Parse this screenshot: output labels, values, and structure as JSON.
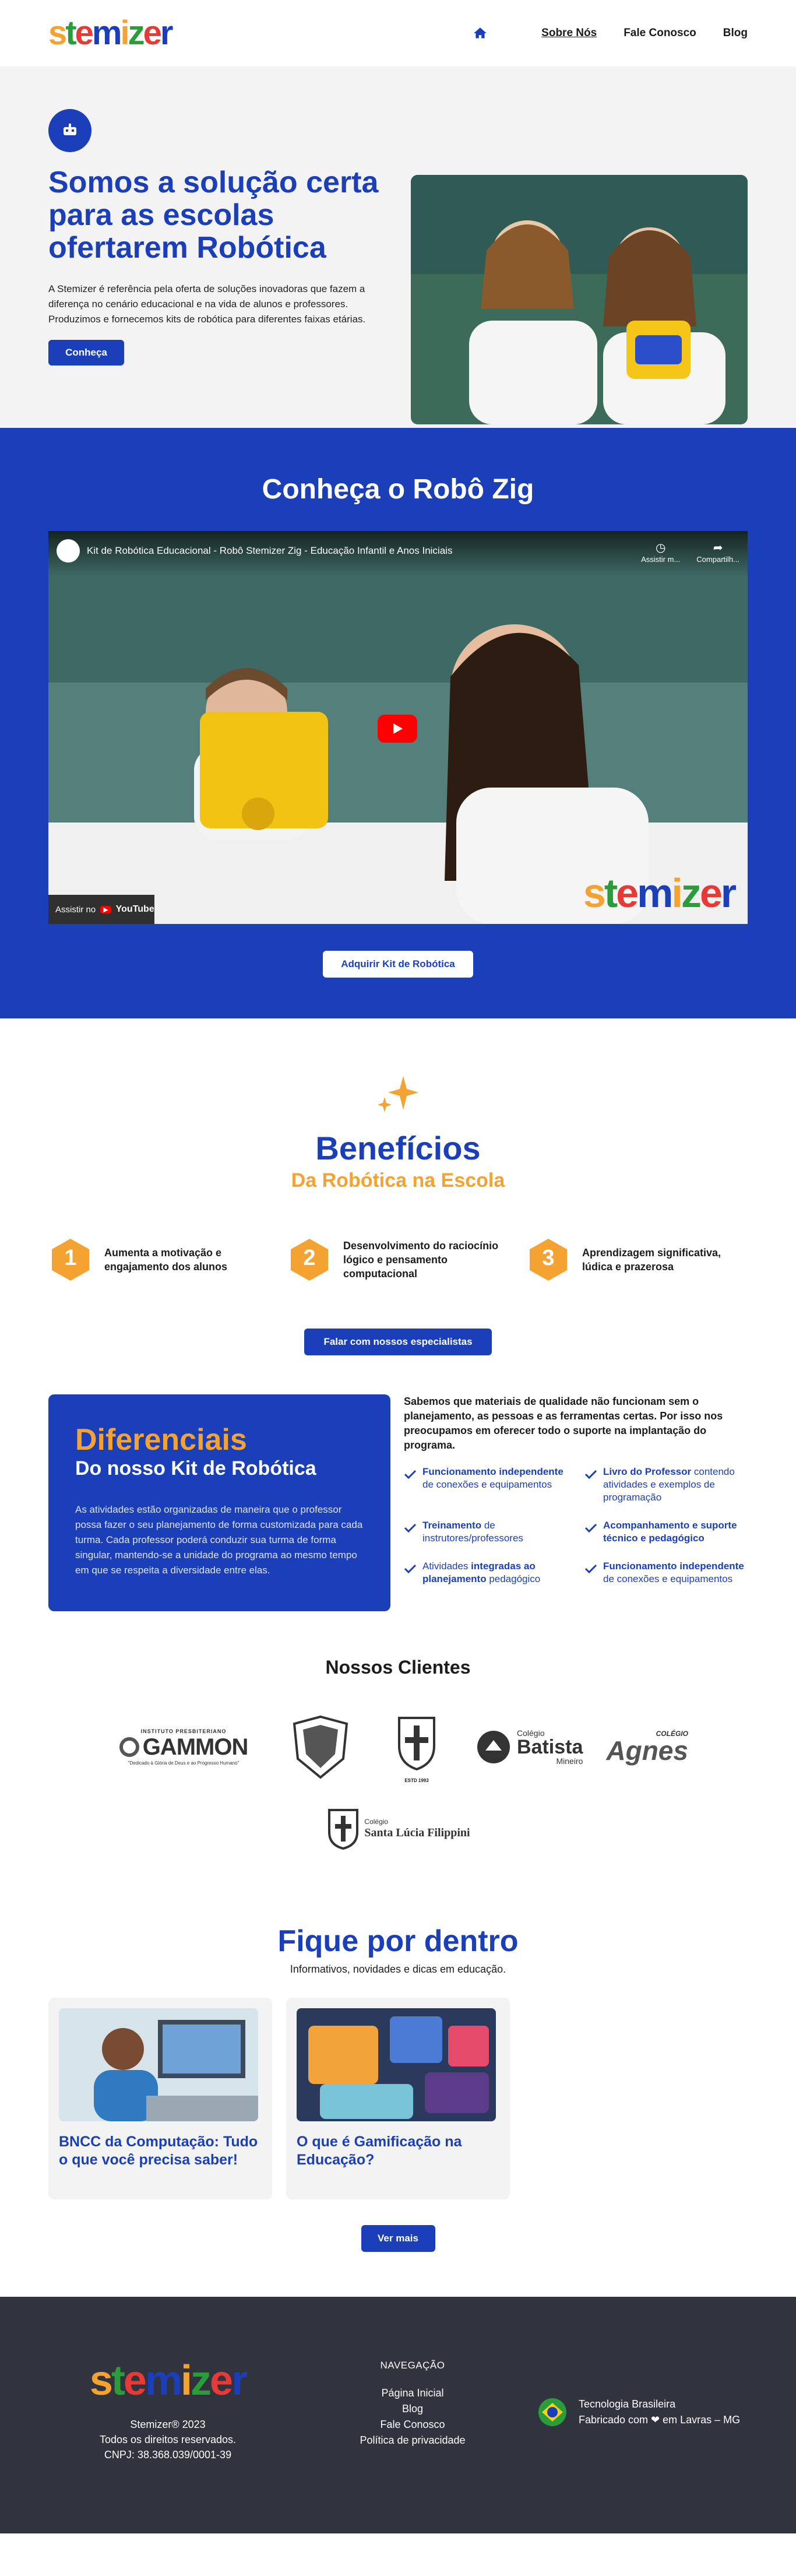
{
  "brand": {
    "letters": [
      "s",
      "t",
      "e",
      "m",
      "i",
      "z",
      "e",
      "r"
    ],
    "colors": [
      "#f4a232",
      "#2a9d3a",
      "#e63a36",
      "#1a3fb8",
      "#f4a232",
      "#2a9d3a",
      "#e63a36",
      "#1a3fb8"
    ],
    "primary": "#1a3fb8",
    "accent": "#f4a232",
    "footer_bg": "#31333e"
  },
  "nav": {
    "home_icon": "home-icon",
    "items": [
      "Sobre Nós",
      "Fale Conosco",
      "Blog"
    ]
  },
  "hero": {
    "title": "Somos a solução certa para as escolas ofertarem Robótica",
    "text": "A Stemizer é referência pela oferta de soluções inovadoras que fazem a diferença no cenário educacional e na vida de alunos e professores. Produzimos e fornecemos kits de robótica para diferentes faixas etárias.",
    "button": "Conheça",
    "badge_icon": "robot-icon"
  },
  "video": {
    "heading": "Conheça o Robô Zig",
    "title": "Kit de Robótica Educacional - Robô Stemizer Zig - Educação Infantil e Anos Iniciais",
    "watch_later": "Assistir m...",
    "share": "Compartilh...",
    "watch_on": "Assistir no",
    "youtube": "YouTube",
    "button": "Adquirir Kit de Robótica"
  },
  "benefits": {
    "title": "Benefícios",
    "subtitle": "Da Robótica na Escola",
    "items": [
      {
        "n": "1",
        "text": "Aumenta a motivação e engajamento dos alunos"
      },
      {
        "n": "2",
        "text": "Desenvolvimento do raciocínio lógico e pensamento computacional"
      },
      {
        "n": "3",
        "text": "Aprendizagem significativa, lúdica e prazerosa"
      }
    ],
    "button": "Falar com nossos especialistas"
  },
  "diferenciais": {
    "title": "Diferenciais",
    "subtitle": "Do nosso Kit de Robótica",
    "text": "As atividades estão organizadas de maneira que o professor possa fazer o seu planejamento de forma customizada para cada turma.  Cada professor poderá conduzir sua turma de forma singular, mantendo-se a unidade do programa ao mesmo tempo em que se respeita a diversidade entre elas.",
    "intro": "Sabemos que materiais de qualidade não funcionam sem o planejamento, as pessoas e as ferramentas certas. Por isso nos preocupamos em oferecer todo o suporte na implantação do programa.",
    "checks": [
      {
        "bold": "Funcionamento independente",
        "rest": " de conexões e equipamentos"
      },
      {
        "bold": "Livro do Professor",
        "rest": " contendo atividades e exemplos de programação"
      },
      {
        "bold": "Treinamento",
        "rest": " de instrutores/professores"
      },
      {
        "bold": "Acompanhamento e suporte técnico e pedagógico",
        "rest": ""
      },
      {
        "pre": "Atividades ",
        "bold": "integradas ao planejamento",
        "rest": " pedagógico"
      },
      {
        "bold": "Funcionamento independente",
        "rest": " de conexões e equipamentos"
      }
    ]
  },
  "clients": {
    "title": "Nossos Clientes",
    "logos": [
      {
        "name": "GAMMON",
        "sub": "INSTITUTO PRESBITERIANO",
        "tag": "\"Dedicado à Glória de Deus e ao Progresso Humano\""
      },
      {
        "name": "",
        "sub": ""
      },
      {
        "name": "",
        "sub": "",
        "tag": "ESTD 1993"
      },
      {
        "name": "Batista",
        "sub": "Colégio",
        "tag": "Mineiro"
      },
      {
        "name": "Agnes",
        "sub": "COLÉGIO"
      },
      {
        "name": "Santa Lúcia Filippini",
        "sub": "Colégio"
      }
    ]
  },
  "blog": {
    "title": "Fique por dentro",
    "subtitle": "Informativos, novidades e dicas em educação.",
    "posts": [
      {
        "title": "BNCC da Computação: Tudo o que você precisa saber!"
      },
      {
        "title": "O que é Gamificação na Educação?"
      }
    ],
    "button": "Ver mais"
  },
  "footer": {
    "copy": "Stemizer® 2023",
    "rights": "Todos os direitos reservados.",
    "cnpj": "CNPJ: 38.368.039/0001-39",
    "nav_title": "NAVEGAÇÃO",
    "links": [
      "Página Inicial",
      "Blog",
      "Fale Conosco",
      "Política de privacidade"
    ],
    "made1": "Tecnologia Brasileira",
    "made2": "Fabricado com ❤ em Lavras – MG"
  }
}
